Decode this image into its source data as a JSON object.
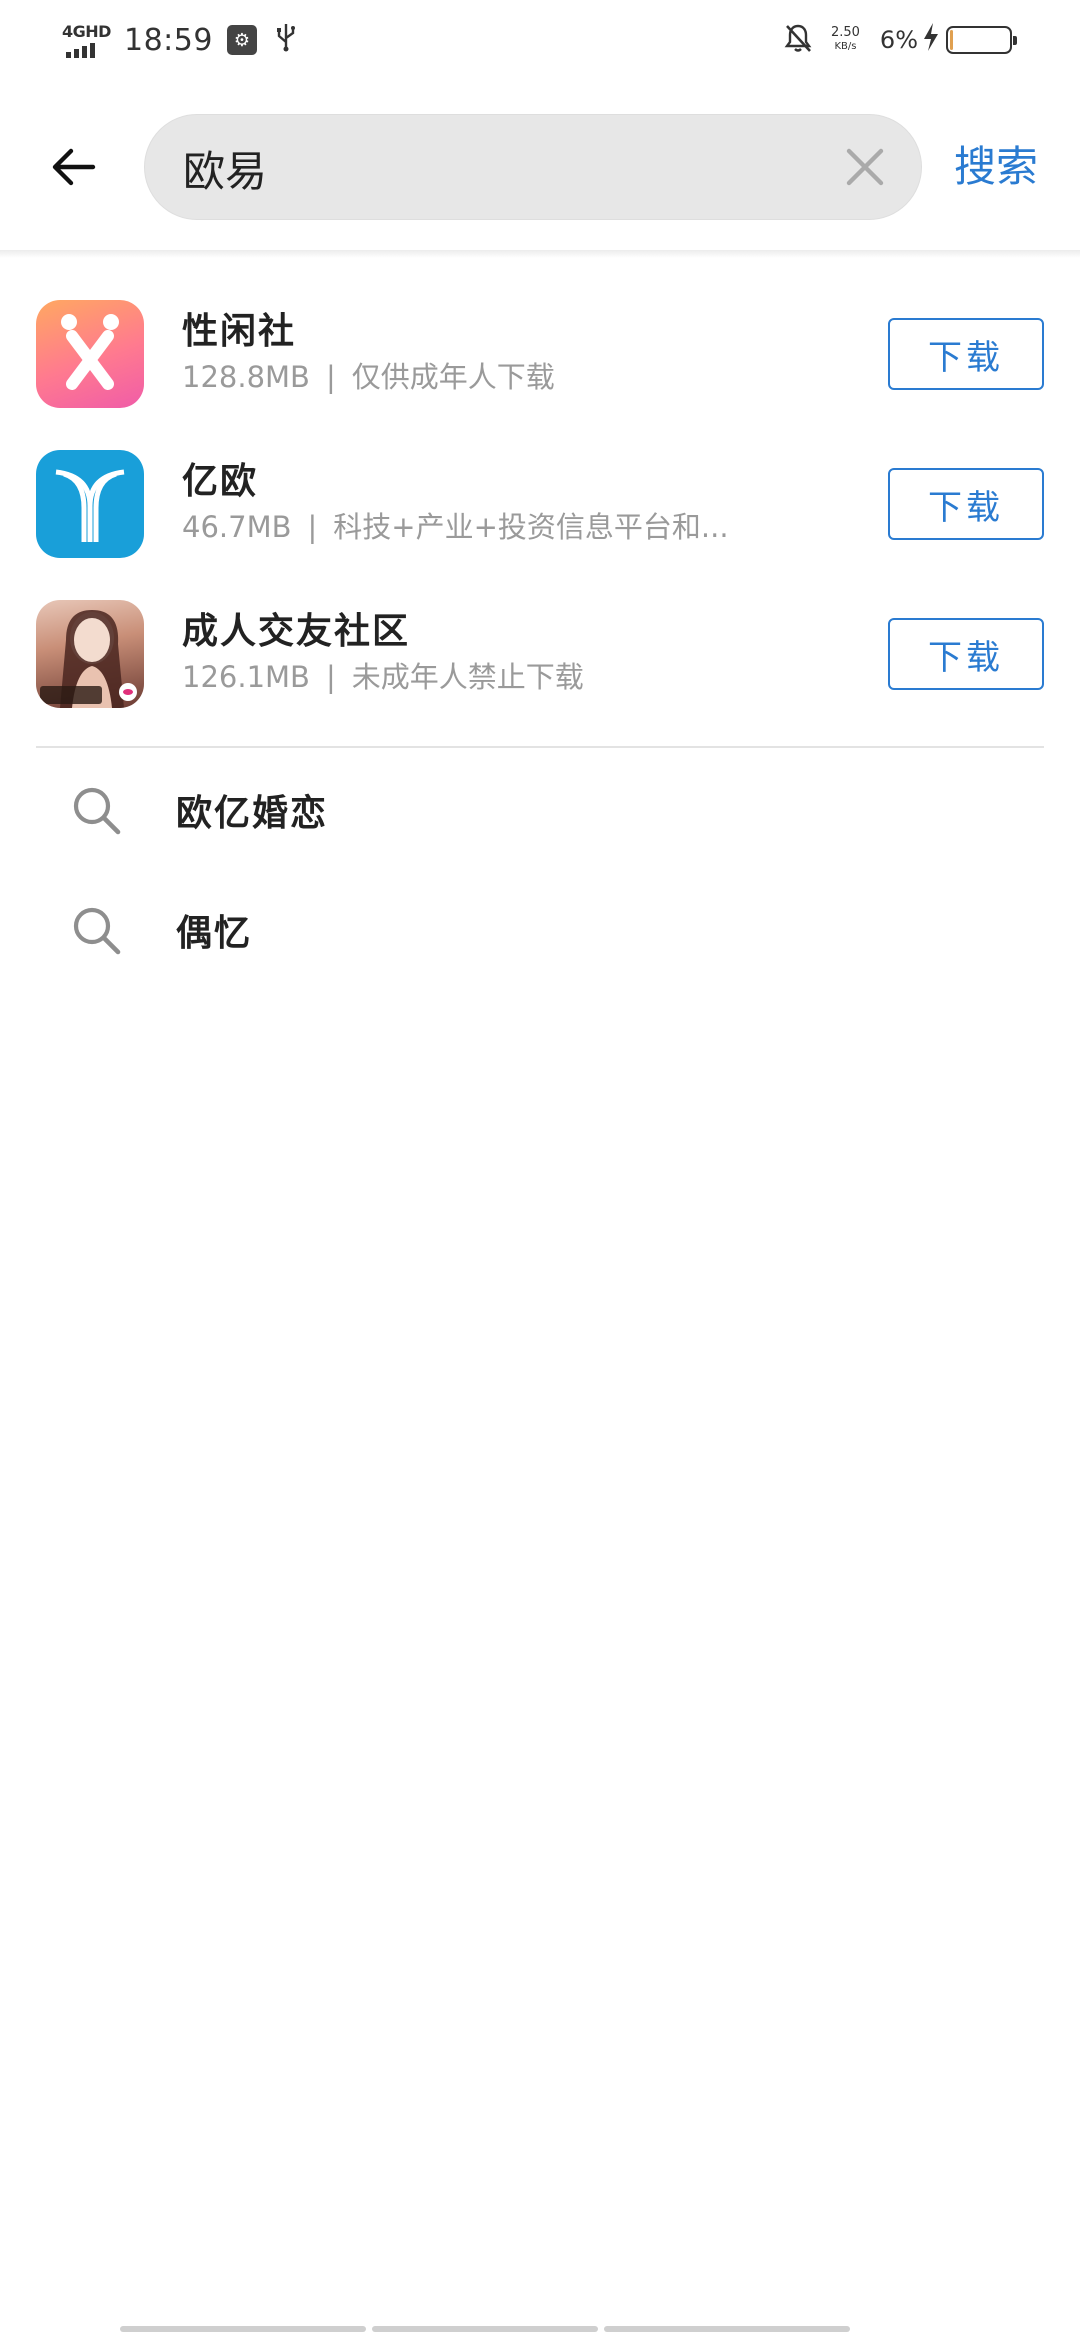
{
  "status_bar": {
    "network": "4GHD",
    "time": "18:59",
    "net_speed_value": "2.50",
    "net_speed_unit": "KB/s",
    "battery_percent": "6%",
    "battery_level": 0.06,
    "icons": [
      "signal-icon",
      "usb-debug-icon",
      "usb-icon",
      "mute-bell-icon",
      "charging-bolt-icon",
      "battery-icon"
    ]
  },
  "search": {
    "query": "欧易",
    "submit_label": "搜索",
    "icons": {
      "back": "arrow-left-icon",
      "clear": "close-icon"
    },
    "accent_color": "#2a7bd1"
  },
  "apps": [
    {
      "name": "性闲社",
      "size": "128.8MB",
      "separator": "|",
      "desc": "仅供成年人下载",
      "action": "下载",
      "icon": "x-logo-icon"
    },
    {
      "name": "亿欧",
      "size": "46.7MB",
      "separator": "|",
      "desc": "科技+产业+投资信息平台和...",
      "action": "下载",
      "icon": "y-logo-icon"
    },
    {
      "name": "成人交友社区",
      "size": "126.1MB",
      "separator": "|",
      "desc": "未成年人禁止下载",
      "action": "下载",
      "icon": "portrait-logo-icon"
    }
  ],
  "suggestions": [
    {
      "label": "欧亿婚恋",
      "icon": "search-icon"
    },
    {
      "label": "偶忆",
      "icon": "search-icon"
    }
  ]
}
